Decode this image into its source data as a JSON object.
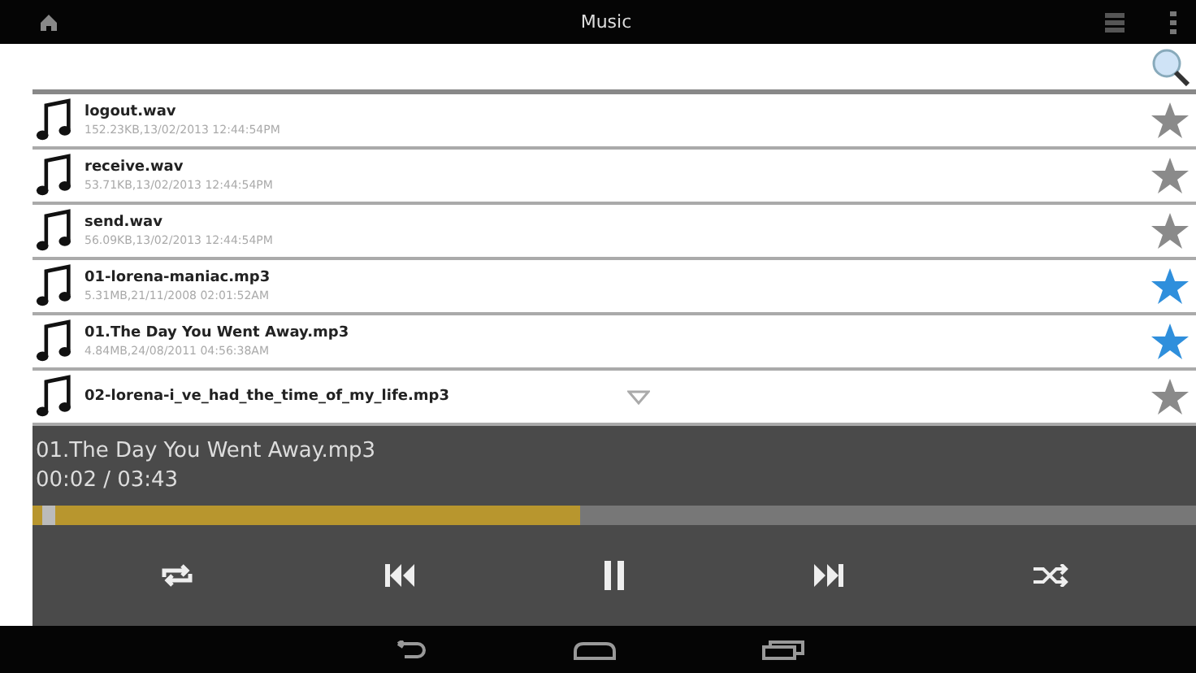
{
  "action_bar": {
    "title": "Music"
  },
  "tracks": [
    {
      "title": "logout.wav",
      "meta": "152.23KB,13/02/2013 12:44:54PM",
      "starred": false
    },
    {
      "title": "receive.wav",
      "meta": "53.71KB,13/02/2013 12:44:54PM",
      "starred": false
    },
    {
      "title": "send.wav",
      "meta": "56.09KB,13/02/2013 12:44:54PM",
      "starred": false
    },
    {
      "title": "01-lorena-maniac.mp3",
      "meta": "5.31MB,21/11/2008 02:01:52AM",
      "starred": true
    },
    {
      "title": "01.The Day You Went Away.mp3",
      "meta": "4.84MB,24/08/2011 04:56:38AM",
      "starred": true
    },
    {
      "title": "02-lorena-i_ve_had_the_time_of_my_life.mp3",
      "starred": false,
      "expandable": true
    }
  ],
  "player": {
    "now_playing": "01.The Day You Went Away.mp3",
    "time": "00:02 / 03:43",
    "level": 0.47,
    "playing": true
  }
}
